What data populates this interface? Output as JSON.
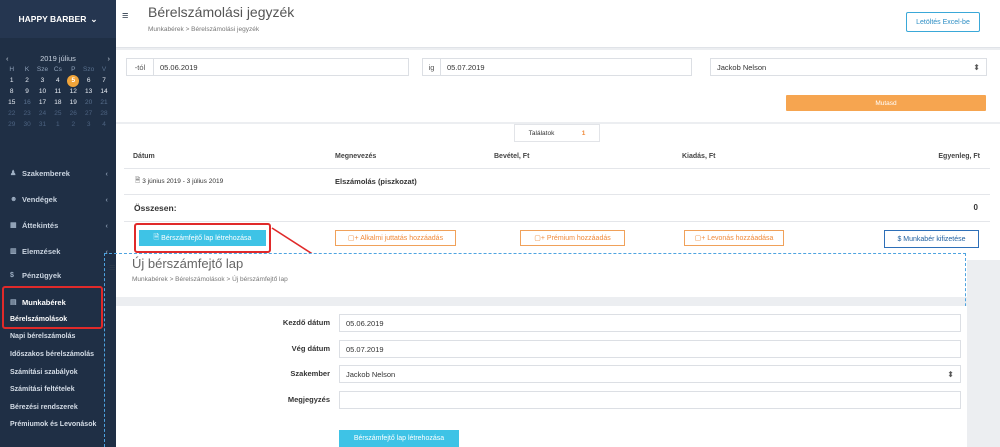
{
  "sidebar": {
    "brand": "HAPPY BARBER",
    "calendar": {
      "month": "2019 július",
      "weekdays": [
        "H",
        "K",
        "Sze",
        "Cs",
        "P",
        "Szo",
        "V"
      ],
      "rows": [
        [
          "1",
          "2",
          "3",
          "4",
          "5",
          "6",
          "7"
        ],
        [
          "8",
          "9",
          "10",
          "11",
          "12",
          "13",
          "14"
        ],
        [
          "15",
          "16",
          "17",
          "18",
          "19",
          "20",
          "21"
        ],
        [
          "22",
          "23",
          "24",
          "25",
          "26",
          "27",
          "28"
        ],
        [
          "29",
          "30",
          "31",
          "1",
          "2",
          "3",
          "4"
        ]
      ]
    },
    "menu": [
      "Szakemberek",
      "Vendégek",
      "Áttekintés",
      "Elemzések",
      "Pénzügyek",
      "Munkabérek"
    ],
    "submenu": [
      "Bérelszámolások",
      "Napi bérelszámolás",
      "Időszakos bérelszámolás",
      "Számítási szabályok",
      "Számítási feltételek",
      "Bérezési rendszerek",
      "Prémiumok és Levonások"
    ]
  },
  "header": {
    "title": "Bérelszámolási jegyzék",
    "breadcrumb": "Munkabérek  >  Bérelszámolási jegyzék",
    "excel_button": "Letöltés Excel-be"
  },
  "filters": {
    "from_label": "-tól",
    "from_value": "05.06.2019",
    "to_label": "ig",
    "to_value": "05.07.2019",
    "specialist": "Jackob Nelson",
    "show_button": "Mutasd"
  },
  "results": {
    "label": "Találatok",
    "count": "1"
  },
  "table": {
    "headers": [
      "Dátum",
      "Megnevezés",
      "Bevétel, Ft",
      "Kiadás, Ft",
      "Egyenleg, Ft"
    ],
    "row_date": "3 június 2019 - 3 július 2019",
    "row_name": "Elszámolás (piszkozat)",
    "total_label": "Összesen:",
    "total_value": "0"
  },
  "actions": {
    "create_sheet": "Bérszámfejtő lap létrehozása",
    "bonus": "+ Alkalmi juttatás hozzáadás",
    "premium": "+ Prémium hozzáadás",
    "deduction": "+ Levonás hozzáadása",
    "pay": "$ Munkabér kifizetése"
  },
  "overlay": {
    "title": "Új bérszámfejtő lap",
    "breadcrumb": "Munkabérek  >  Bérelszámolások  >  Új bérszámfejtő lap",
    "fields": {
      "start_label": "Kezdő dátum",
      "start_value": "05.06.2019",
      "end_label": "Vég dátum",
      "end_value": "05.07.2019",
      "specialist_label": "Szakember",
      "specialist_value": "Jackob Nelson",
      "note_label": "Megjegyzés",
      "note_value": ""
    },
    "submit": "Bérszámfejtő lap létrehozása"
  },
  "colors": {
    "sidebar_bg": "#1f2f45",
    "accent_blue": "#3aa8d8",
    "accent_orange": "#f6a550",
    "highlight_red": "#e02a2a"
  }
}
